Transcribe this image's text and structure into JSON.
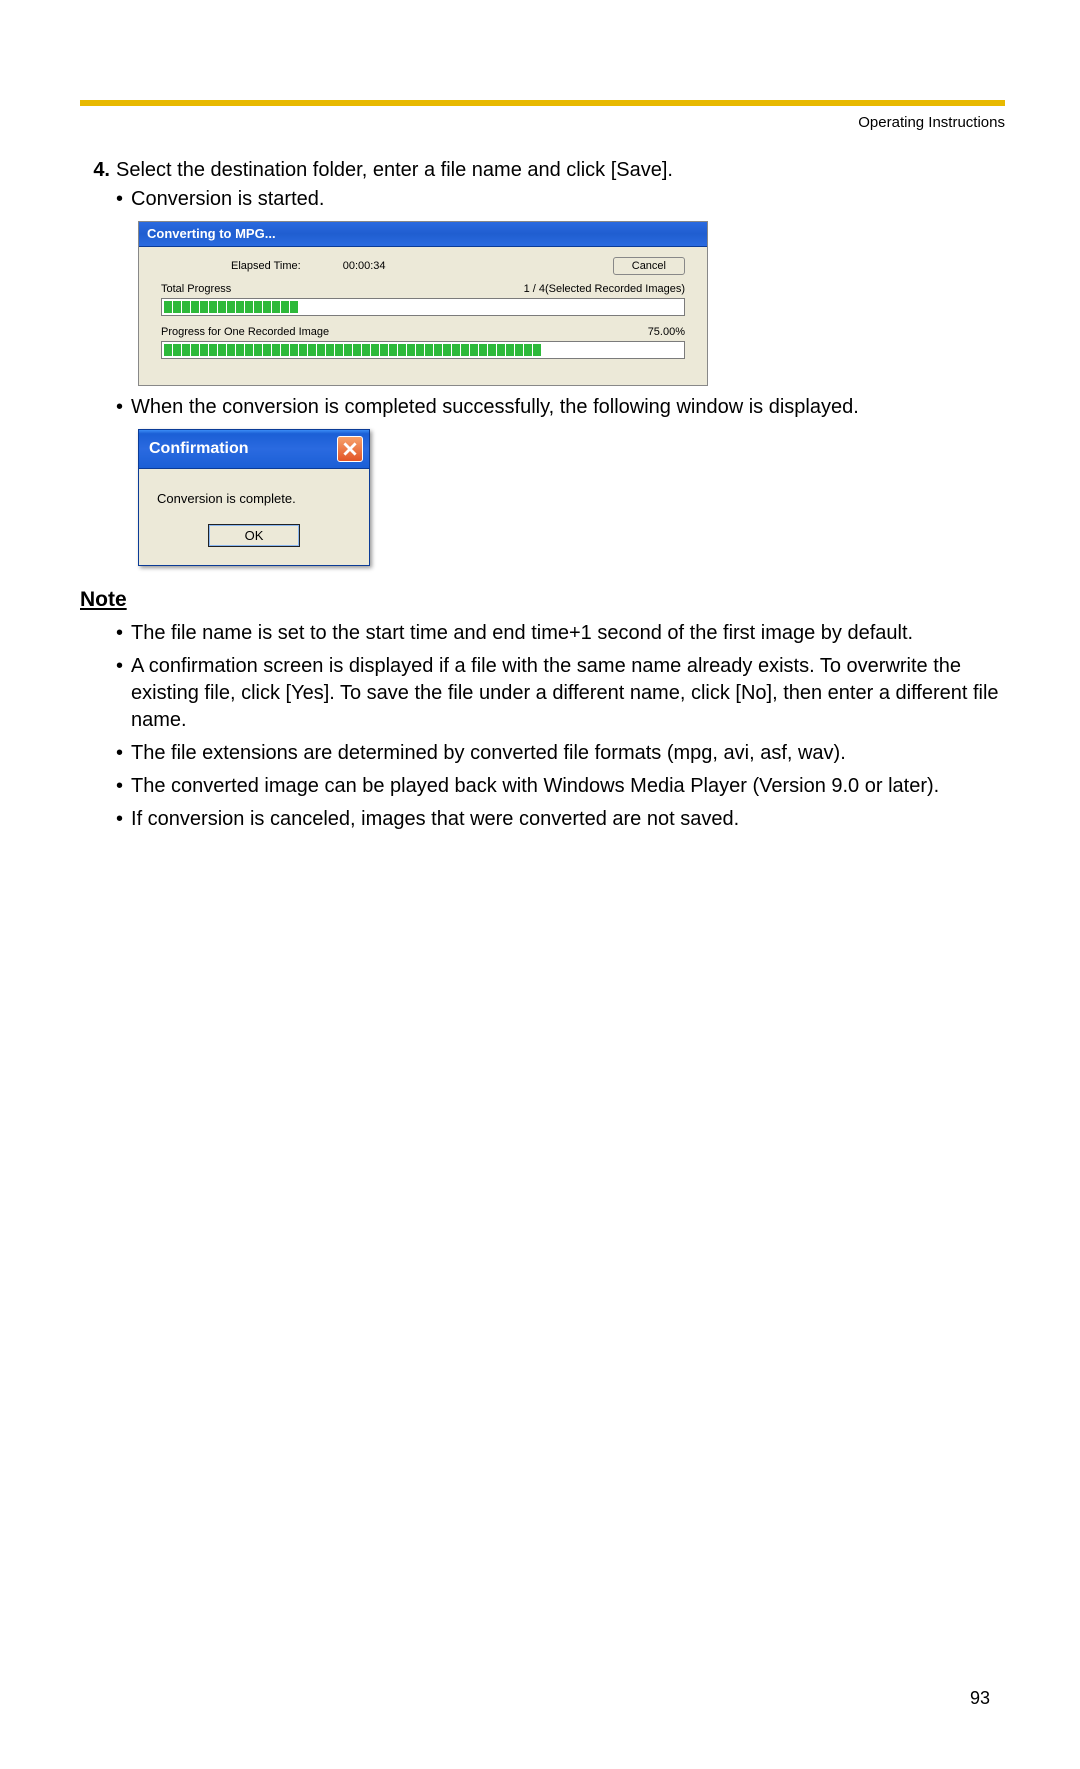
{
  "header": "Operating Instructions",
  "step": {
    "number": "4.",
    "text": "Select the destination folder, enter a file name and click [Save].",
    "bullet1": "Conversion is started.",
    "bullet2": "When the conversion is completed successfully, the following window is displayed."
  },
  "dialog1": {
    "title": "Converting to MPG...",
    "elapsed_label": "Elapsed Time:",
    "elapsed_value": "00:00:34",
    "cancel_label": "Cancel",
    "total_label": "Total Progress",
    "total_status": "1 / 4(Selected Recorded Images)",
    "one_label": "Progress for One Recorded Image",
    "one_percent": "75.00%"
  },
  "dialog2": {
    "title": "Confirmation",
    "message": "Conversion is complete.",
    "ok_label": "OK"
  },
  "note_heading": "Note",
  "notes": [
    "The file name is set to the start time and end time+1 second of the first image by default.",
    "A confirmation screen is displayed if a file with the same name already exists. To overwrite the existing file, click [Yes]. To save the file under a different name, click [No], then enter a different file name.",
    "The file extensions are determined by converted file formats (mpg, avi, asf, wav).",
    "The converted image can be played back with Windows Media Player (Version 9.0 or later).",
    "If conversion is canceled, images that were converted are not saved."
  ],
  "page_number": "93"
}
